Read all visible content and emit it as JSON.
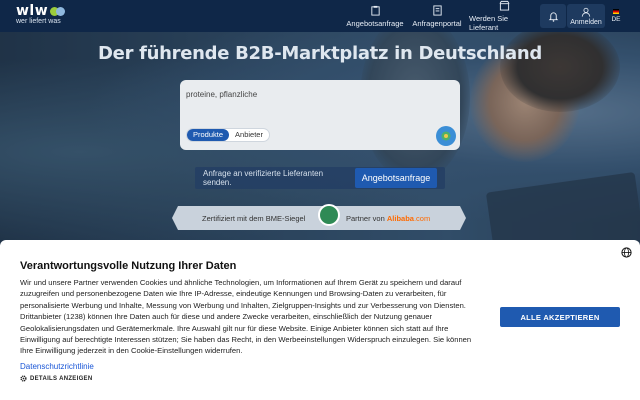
{
  "header": {
    "logo_word": "wlw",
    "logo_tagline": "wer liefert was",
    "nav": [
      {
        "label": "Angebotsanfrage",
        "icon": "inquiry-icon"
      },
      {
        "label": "Anfragenportal",
        "icon": "portal-icon"
      },
      {
        "label": "Werden Sie Lieferant",
        "icon": "store-icon"
      }
    ],
    "login_label": "Anmelden",
    "language": "DE"
  },
  "hero": {
    "title": "Der führende B2B-Marktplatz in Deutschland",
    "search_value": "proteine, pflanzliche",
    "tabs": [
      {
        "label": "Produkte",
        "active": true
      },
      {
        "label": "Anbieter",
        "active": false
      }
    ],
    "cta_text": "Anfrage an verifizierte Lieferanten senden.",
    "cta_button": "Angebotsanfrage",
    "cert_text": "Zertifiziert mit dem BME-Siegel",
    "partner_text": "Partner von",
    "partner_brand": "Alibaba",
    "partner_tld": ".com"
  },
  "consent": {
    "title": "Verantwortungsvolle Nutzung Ihrer Daten",
    "body": "Wir und unsere Partner verwenden Cookies und ähnliche Technologien, um Informationen auf Ihrem Gerät zu speichern und darauf zuzugreifen und personenbezogene Daten wie Ihre IP-Adresse, eindeutige Kennungen und Browsing-Daten zu verarbeiten, für personalisierte Werbung und Inhalte, Messung von Werbung und Inhalten, Zielgruppen-Insights und zur Verbesserung von Diensten. Drittanbieter (1238) können Ihre Daten auch für diese und andere Zwecke verarbeiten, einschließlich der Nutzung genauer Geolokalisierungsdaten und Gerätemerkmale. Ihre Auswahl gilt nur für diese Website. Einige Anbieter können sich statt auf Ihre Einwilligung auf berechtigte Interessen stützen; Sie haben das Recht, in den Werbeeinstellungen Widerspruch einzulegen. Sie können Ihre Einwilligung jederzeit in den Cookie-Einstellungen widerrufen.",
    "privacy_link": "Datenschutzrichtlinie",
    "details_label": "DETAILS ANZEIGEN",
    "accept_label": "ALLE AKZEPTIEREN"
  },
  "colors": {
    "header_bg": "#0f2748",
    "primary_blue": "#1f5ab0",
    "logo_dot_1": "#9ccc3c",
    "logo_dot_2": "#8fb8de",
    "alibaba_orange": "#ff6a00"
  }
}
